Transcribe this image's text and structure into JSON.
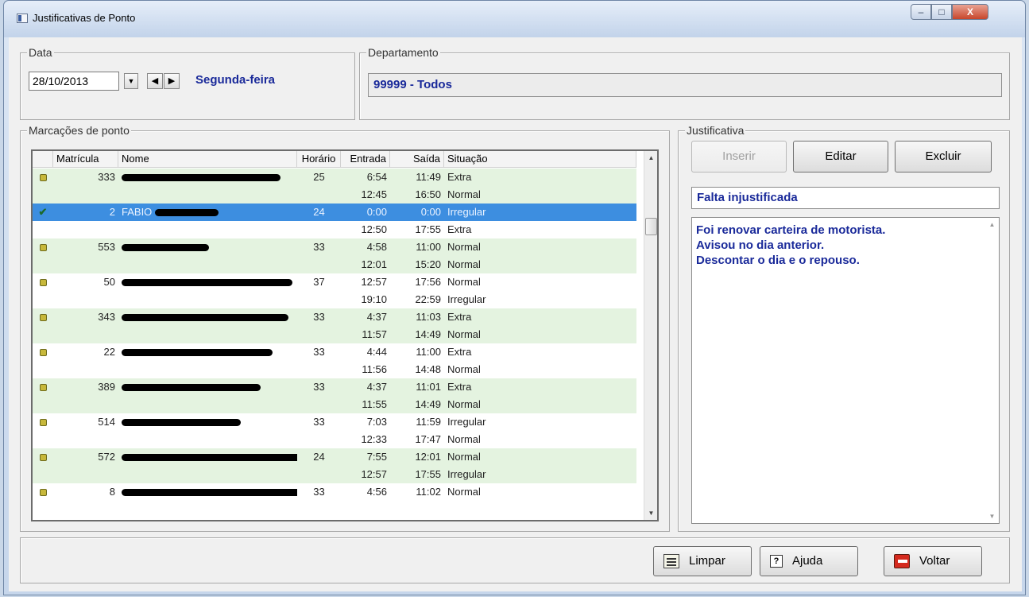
{
  "window": {
    "title": "Justificativas de Ponto",
    "min": "–",
    "max": "□",
    "close": "X"
  },
  "data": {
    "label": "Data",
    "date": "28/10/2013",
    "dropdown": "▼",
    "prev": "◀",
    "next": "▶",
    "weekday": "Segunda-feira"
  },
  "departamento": {
    "label": "Departamento",
    "value": "99999 - Todos"
  },
  "marcacoes": {
    "label": "Marcações de ponto",
    "columns": [
      "Matrícula",
      "Nome",
      "Horário",
      "Entrada",
      "Saída",
      "Situação"
    ],
    "rows": [
      {
        "mat": "333",
        "nome": "",
        "hor": "25",
        "ent": "6:54",
        "sai": "11:49",
        "sit": "Extra"
      },
      {
        "mat": "",
        "nome": "",
        "hor": "",
        "ent": "12:45",
        "sai": "16:50",
        "sit": "Normal"
      },
      {
        "mat": "2",
        "nome": "FABIO",
        "hor": "24",
        "ent": "0:00",
        "sai": "0:00",
        "sit": "Irregular"
      },
      {
        "mat": "",
        "nome": "",
        "hor": "",
        "ent": "12:50",
        "sai": "17:55",
        "sit": "Extra"
      },
      {
        "mat": "553",
        "nome": "",
        "hor": "33",
        "ent": "4:58",
        "sai": "11:00",
        "sit": "Normal"
      },
      {
        "mat": "",
        "nome": "",
        "hor": "",
        "ent": "12:01",
        "sai": "15:20",
        "sit": "Normal"
      },
      {
        "mat": "50",
        "nome": "",
        "hor": "37",
        "ent": "12:57",
        "sai": "17:56",
        "sit": "Normal"
      },
      {
        "mat": "",
        "nome": "",
        "hor": "",
        "ent": "19:10",
        "sai": "22:59",
        "sit": "Irregular"
      },
      {
        "mat": "343",
        "nome": "",
        "hor": "33",
        "ent": "4:37",
        "sai": "11:03",
        "sit": "Extra"
      },
      {
        "mat": "",
        "nome": "",
        "hor": "",
        "ent": "11:57",
        "sai": "14:49",
        "sit": "Normal"
      },
      {
        "mat": "22",
        "nome": "",
        "hor": "33",
        "ent": "4:44",
        "sai": "11:00",
        "sit": "Extra"
      },
      {
        "mat": "",
        "nome": "",
        "hor": "",
        "ent": "11:56",
        "sai": "14:48",
        "sit": "Normal"
      },
      {
        "mat": "389",
        "nome": "",
        "hor": "33",
        "ent": "4:37",
        "sai": "11:01",
        "sit": "Extra"
      },
      {
        "mat": "",
        "nome": "",
        "hor": "",
        "ent": "11:55",
        "sai": "14:49",
        "sit": "Normal"
      },
      {
        "mat": "514",
        "nome": "",
        "hor": "33",
        "ent": "7:03",
        "sai": "11:59",
        "sit": "Irregular"
      },
      {
        "mat": "",
        "nome": "",
        "hor": "",
        "ent": "12:33",
        "sai": "17:47",
        "sit": "Normal"
      },
      {
        "mat": "572",
        "nome": "",
        "hor": "24",
        "ent": "7:55",
        "sai": "12:01",
        "sit": "Normal"
      },
      {
        "mat": "",
        "nome": "",
        "hor": "",
        "ent": "12:57",
        "sai": "17:55",
        "sit": "Irregular"
      },
      {
        "mat": "8",
        "nome": "",
        "hor": "33",
        "ent": "4:56",
        "sai": "11:02",
        "sit": "Normal"
      }
    ]
  },
  "justificativa": {
    "label": "Justificativa",
    "inserir": "Inserir",
    "editar": "Editar",
    "excluir": "Excluir",
    "title": "Falta injustificada",
    "text": [
      "Foi renovar carteira de motorista.",
      "Avisou no dia anterior.",
      "Descontar o dia e o repouso."
    ]
  },
  "bottom": {
    "limpar": "Limpar",
    "ajuda": "Ajuda",
    "voltar": "Voltar"
  },
  "colors": {
    "row_green": "#e4f3e0",
    "selected": "#3d8ee0",
    "accent_text": "#1a2a9a"
  }
}
